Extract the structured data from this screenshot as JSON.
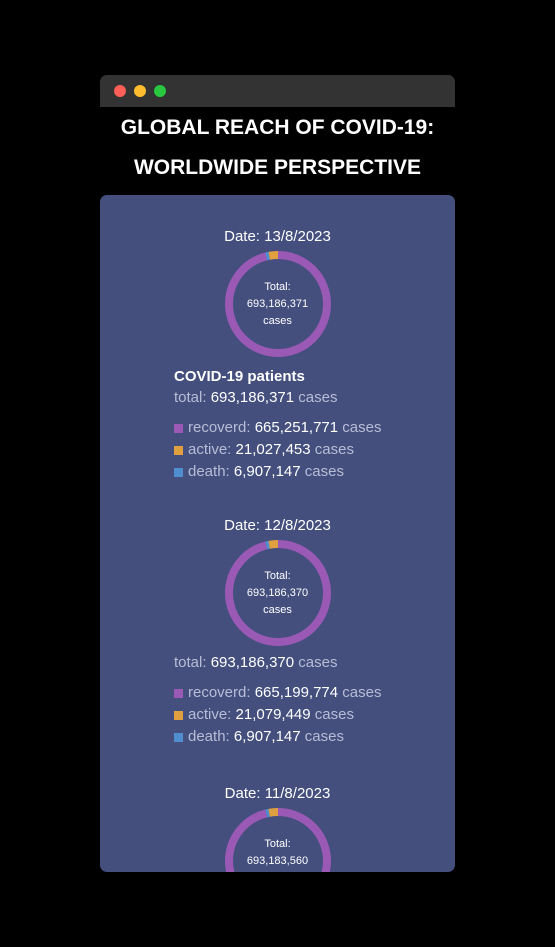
{
  "window": {
    "title_line1": "GLOBAL REACH OF COVID-19:",
    "title_line2": "WORLDWIDE PERSPECTIVE"
  },
  "colors": {
    "recovered": "#9b59b6",
    "active": "#e0a040",
    "death": "#4f8fd0"
  },
  "section_title": "COVID-19 patients",
  "labels": {
    "date_prefix": "Date: ",
    "center_total": "Total:",
    "center_cases": "cases",
    "total": "total:",
    "recovered": "recoverd:",
    "active": "active:",
    "death": "death:",
    "cases": "cases"
  },
  "entries": [
    {
      "date": "Date: 13/8/2023",
      "total": "693,186,371",
      "recovered": "665,251,771",
      "active": "21,027,453",
      "death": "6,907,147",
      "chart_values": {
        "recovered": 665251771,
        "active": 21027453,
        "death": 6907147
      }
    },
    {
      "date": "Date: 12/8/2023",
      "total": "693,186,370",
      "recovered": "665,199,774",
      "active": "21,079,449",
      "death": "6,907,147",
      "chart_values": {
        "recovered": 665199774,
        "active": 21079449,
        "death": 6907147
      }
    },
    {
      "date": "Date: 11/8/2023",
      "total": "693,183,560",
      "chart_values": {
        "recovered": 665199774,
        "active": 21079449,
        "death": 6907147
      }
    }
  ]
}
